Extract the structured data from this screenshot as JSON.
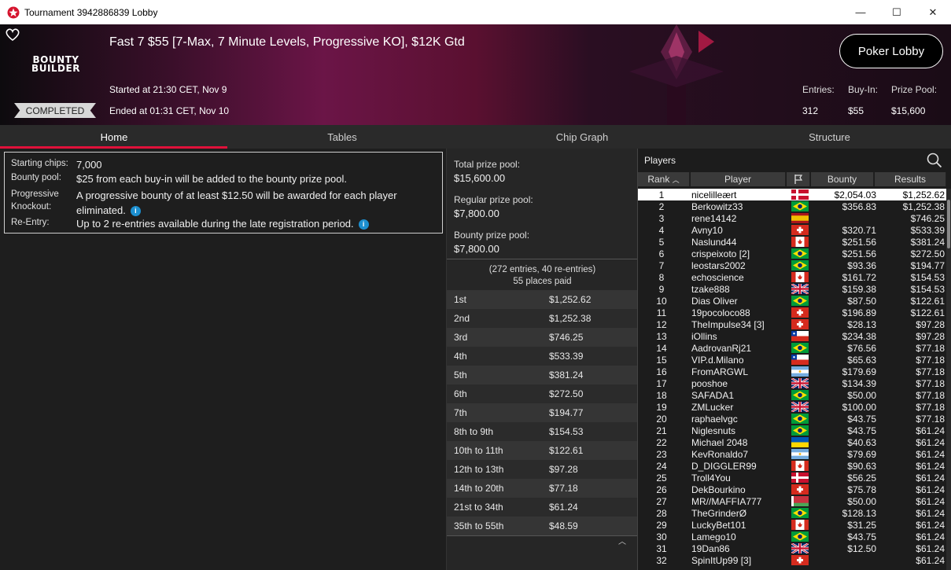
{
  "window": {
    "title": "Tournament 3942886839 Lobby",
    "minimize": "—",
    "maximize": "☐",
    "close": "✕"
  },
  "banner": {
    "logo_line1": "BOUNTY",
    "logo_line2": "BUILDER",
    "tournament_name": "Fast 7 $55 [7-Max, 7 Minute Levels, Progressive KO], $12K Gtd",
    "started": "Started at 21:30 CET, Nov 9",
    "ended": "Ended at 01:31 CET, Nov 10",
    "status": "COMPLETED",
    "lobby_button": "Poker Lobby",
    "entries_label": "Entries:",
    "entries_value": "312",
    "buyin_label": "Buy-In:",
    "buyin_value": "$55",
    "prizepool_label": "Prize Pool:",
    "prizepool_value": "$15,600"
  },
  "tabs": [
    {
      "label": "Home"
    },
    {
      "label": "Tables"
    },
    {
      "label": "Chip Graph"
    },
    {
      "label": "Structure"
    }
  ],
  "info": {
    "starting_chips_label": "Starting chips:",
    "starting_chips_value": "7,000",
    "bounty_pool_label": "Bounty pool:",
    "bounty_pool_value": "$25 from each buy-in will be added to the bounty prize pool.",
    "pko_label_1": "Progressive",
    "pko_label_2": "Knockout:",
    "pko_value_1": "A progressive bounty of at least $12.50 will be awarded for each player",
    "pko_value_2": "eliminated.",
    "reentry_label": "Re-Entry:",
    "reentry_value": "Up to 2 re-entries available during the late registration period."
  },
  "prize": {
    "total_label": "Total prize pool:",
    "total_value": "$15,600.00",
    "regular_label": "Regular prize pool:",
    "regular_value": "$7,800.00",
    "bounty_label": "Bounty prize pool:",
    "bounty_value": "$7,800.00",
    "entries_note": "(272 entries, 40 re-entries)",
    "places_paid": "55 places paid",
    "payouts": [
      {
        "place": "1st",
        "amount": "$1,252.62"
      },
      {
        "place": "2nd",
        "amount": "$1,252.38"
      },
      {
        "place": "3rd",
        "amount": "$746.25"
      },
      {
        "place": "4th",
        "amount": "$533.39"
      },
      {
        "place": "5th",
        "amount": "$381.24"
      },
      {
        "place": "6th",
        "amount": "$272.50"
      },
      {
        "place": "7th",
        "amount": "$194.77"
      },
      {
        "place": "8th to 9th",
        "amount": "$154.53"
      },
      {
        "place": "10th to 11th",
        "amount": "$122.61"
      },
      {
        "place": "12th to 13th",
        "amount": "$97.28"
      },
      {
        "place": "14th to 20th",
        "amount": "$77.18"
      },
      {
        "place": "21st to 34th",
        "amount": "$61.24"
      },
      {
        "place": "35th to 55th",
        "amount": "$48.59"
      }
    ]
  },
  "players": {
    "title": "Players",
    "columns": {
      "rank": "Rank",
      "player": "Player",
      "bounty": "Bounty",
      "results": "Results"
    },
    "rows": [
      {
        "rank": "1",
        "name": "nicelilleært",
        "flag": "DK",
        "bounty": "$2,054.03",
        "result": "$1,252.62"
      },
      {
        "rank": "2",
        "name": "Berkowitz33",
        "flag": "BR",
        "bounty": "$356.83",
        "result": "$1,252.38"
      },
      {
        "rank": "3",
        "name": "rene14142",
        "flag": "ES",
        "bounty": "",
        "result": "$746.25"
      },
      {
        "rank": "4",
        "name": "Avny10",
        "flag": "CH",
        "bounty": "$320.71",
        "result": "$533.39"
      },
      {
        "rank": "5",
        "name": "Naslund44",
        "flag": "CA",
        "bounty": "$251.56",
        "result": "$381.24"
      },
      {
        "rank": "6",
        "name": "crispeixoto [2]",
        "flag": "BR",
        "bounty": "$251.56",
        "result": "$272.50"
      },
      {
        "rank": "7",
        "name": "leostars2002",
        "flag": "BR",
        "bounty": "$93.36",
        "result": "$194.77"
      },
      {
        "rank": "8",
        "name": "echoscience",
        "flag": "CA",
        "bounty": "$161.72",
        "result": "$154.53"
      },
      {
        "rank": "9",
        "name": "tzake888",
        "flag": "GB",
        "bounty": "$159.38",
        "result": "$154.53"
      },
      {
        "rank": "10",
        "name": "Dias Oliver",
        "flag": "BR",
        "bounty": "$87.50",
        "result": "$122.61"
      },
      {
        "rank": "11",
        "name": "19pocoloco88",
        "flag": "CH",
        "bounty": "$196.89",
        "result": "$122.61"
      },
      {
        "rank": "12",
        "name": "TheImpulse34 [3]",
        "flag": "CH",
        "bounty": "$28.13",
        "result": "$97.28"
      },
      {
        "rank": "13",
        "name": "iOllins",
        "flag": "CL",
        "bounty": "$234.38",
        "result": "$97.28"
      },
      {
        "rank": "14",
        "name": "AadrovanRj21",
        "flag": "BR",
        "bounty": "$76.56",
        "result": "$77.18"
      },
      {
        "rank": "15",
        "name": "VIP.d.Milano",
        "flag": "CL",
        "bounty": "$65.63",
        "result": "$77.18"
      },
      {
        "rank": "16",
        "name": "FromARGWL",
        "flag": "AR",
        "bounty": "$179.69",
        "result": "$77.18"
      },
      {
        "rank": "17",
        "name": "pooshoe",
        "flag": "GB",
        "bounty": "$134.39",
        "result": "$77.18"
      },
      {
        "rank": "18",
        "name": "SAFADA1",
        "flag": "BR",
        "bounty": "$50.00",
        "result": "$77.18"
      },
      {
        "rank": "19",
        "name": "ZMLucker",
        "flag": "GB",
        "bounty": "$100.00",
        "result": "$77.18"
      },
      {
        "rank": "20",
        "name": "raphaelvgc",
        "flag": "BR",
        "bounty": "$43.75",
        "result": "$77.18"
      },
      {
        "rank": "21",
        "name": "Niglesnuts",
        "flag": "BR",
        "bounty": "$43.75",
        "result": "$61.24"
      },
      {
        "rank": "22",
        "name": "Michael 2048",
        "flag": "UA",
        "bounty": "$40.63",
        "result": "$61.24"
      },
      {
        "rank": "23",
        "name": "KevRonaldo7",
        "flag": "AR",
        "bounty": "$79.69",
        "result": "$61.24"
      },
      {
        "rank": "24",
        "name": "D_DIGGLER99",
        "flag": "CA",
        "bounty": "$90.63",
        "result": "$61.24"
      },
      {
        "rank": "25",
        "name": "Troll4You",
        "flag": "DK",
        "bounty": "$56.25",
        "result": "$61.24"
      },
      {
        "rank": "26",
        "name": "DekBourkino",
        "flag": "CH",
        "bounty": "$75.78",
        "result": "$61.24"
      },
      {
        "rank": "27",
        "name": "MR//MAFFIA777",
        "flag": "BY",
        "bounty": "$50.00",
        "result": "$61.24"
      },
      {
        "rank": "28",
        "name": "TheGrinderØ",
        "flag": "BR",
        "bounty": "$128.13",
        "result": "$61.24"
      },
      {
        "rank": "29",
        "name": "LuckyBet101",
        "flag": "CA",
        "bounty": "$31.25",
        "result": "$61.24"
      },
      {
        "rank": "30",
        "name": "Lamego10",
        "flag": "BR",
        "bounty": "$43.75",
        "result": "$61.24"
      },
      {
        "rank": "31",
        "name": "19Dan86",
        "flag": "GB",
        "bounty": "$12.50",
        "result": "$61.24"
      },
      {
        "rank": "32",
        "name": "SpinItUp99 [3]",
        "flag": "CH",
        "bounty": "",
        "result": "$61.24"
      }
    ]
  },
  "colors": {
    "accent": "#e0113a",
    "info_icon": "#1c8fd0"
  }
}
